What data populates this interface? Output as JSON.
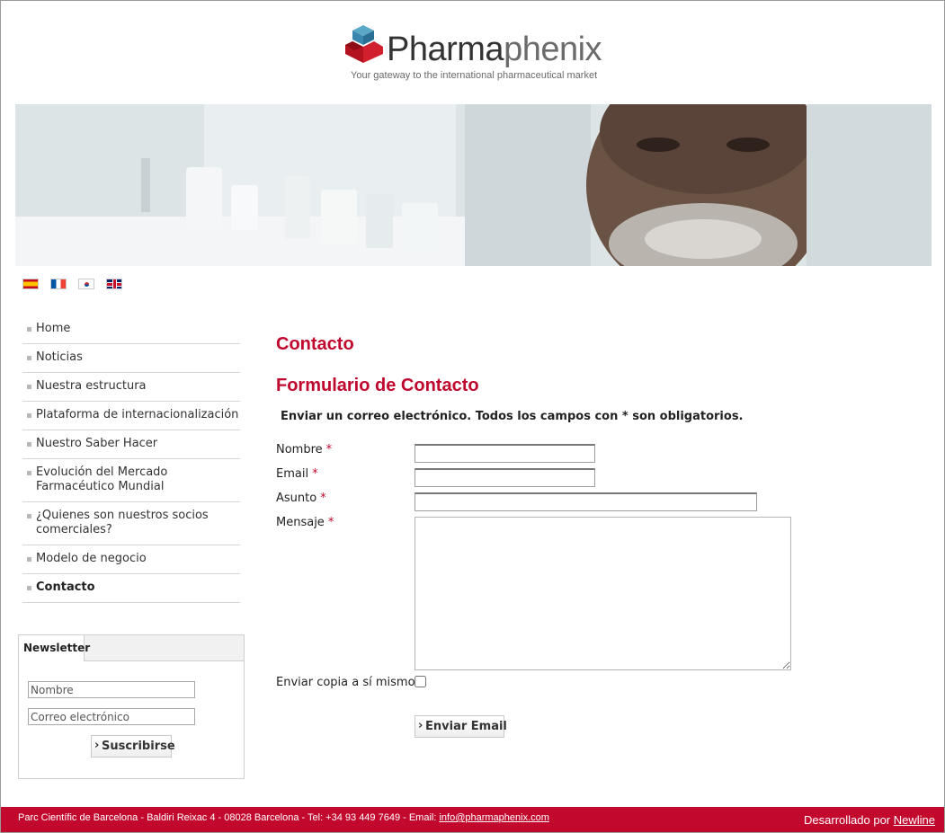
{
  "header": {
    "logo_strong": "Pharma",
    "logo_light": "phenix",
    "tagline": "Your gateway to the international pharmaceutical market"
  },
  "languages": [
    "es-flag-icon",
    "fr-flag-icon",
    "kr-flag-icon",
    "gb-flag-icon"
  ],
  "sidebar": {
    "items": [
      {
        "label": "Home"
      },
      {
        "label": "Noticias"
      },
      {
        "label": "Nuestra estructura"
      },
      {
        "label": "Plataforma de internacionalización"
      },
      {
        "label": "Nuestro Saber Hacer"
      },
      {
        "label": "Evolución del Mercado Farmacéutico Mundial"
      },
      {
        "label": "¿Quienes son nuestros socios comerciales?"
      },
      {
        "label": "Modelo de negocio"
      },
      {
        "label": "Contacto"
      }
    ],
    "active": "Contacto"
  },
  "newsletter": {
    "tab_label": "Newsletter",
    "name_placeholder": "Nombre",
    "email_placeholder": "Correo electrónico",
    "subscribe_label": "Suscribirse"
  },
  "main": {
    "title": "Contacto",
    "form_title": "Formulario de Contacto",
    "description": "Enviar un correo electrónico. Todos los campos con * son obligatorios.",
    "labels": {
      "nombre": "Nombre",
      "email": "Email",
      "asunto": "Asunto",
      "mensaje": "Mensaje",
      "copia": "Enviar copia a sí mismo"
    },
    "required_mark": "*",
    "values": {
      "nombre": "",
      "email": "",
      "asunto": "",
      "mensaje": ""
    },
    "copy_checked": false,
    "send_label": "Enviar Email"
  },
  "footer": {
    "address": "Parc Científic de Barcelona - Baldiri Reixac 4 - 08028 Barcelona - Tel: +34 93 449 7649 - Email: ",
    "email_link": "info@pharmaphenix.com",
    "developed_by": "Desarrollado por ",
    "developer_link": "Newline"
  },
  "colors": {
    "accent": "#c0072d",
    "footer_bg": "#c3082e",
    "menu_bullet": "#b9b9b9"
  }
}
